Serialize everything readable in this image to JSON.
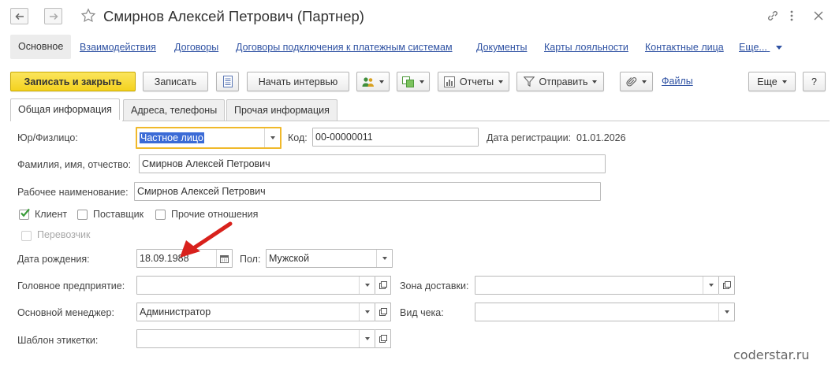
{
  "window": {
    "title": "Смирнов Алексей Петрович (Партнер)"
  },
  "nav": {
    "items": [
      {
        "label": "Основное"
      },
      {
        "label": "Взаимодействия"
      },
      {
        "label": "Договоры"
      },
      {
        "label": "Договоры подключения к платежным системам"
      },
      {
        "label": "Документы"
      },
      {
        "label": "Карты лояльности"
      },
      {
        "label": "Контактные лица"
      },
      {
        "label": "Еще..."
      }
    ]
  },
  "toolbar": {
    "save_close": "Записать и закрыть",
    "save": "Записать",
    "start_interview": "Начать интервью",
    "reports": "Отчеты",
    "send": "Отправить",
    "files": "Файлы",
    "more": "Еще",
    "help": "?"
  },
  "tabs": [
    {
      "label": "Общая информация",
      "active": true
    },
    {
      "label": "Адреса, телефоны",
      "active": false
    },
    {
      "label": "Прочая информация",
      "active": false
    }
  ],
  "form": {
    "legal_type": {
      "label": "Юр/Физлицо:",
      "value": "Частное лицо"
    },
    "code": {
      "label": "Код:",
      "value": "00-00000011"
    },
    "reg_date": {
      "label": "Дата регистрации:",
      "value": "01.01.2026"
    },
    "full_name": {
      "label": "Фамилия, имя, отчество:",
      "value": "Смирнов Алексей Петрович"
    },
    "work_name": {
      "label": "Рабочее наименование:",
      "value": "Смирнов Алексей Петрович"
    },
    "client": {
      "label": "Клиент",
      "checked": true
    },
    "supplier": {
      "label": "Поставщик",
      "checked": false
    },
    "other_relations": {
      "label": "Прочие отношения",
      "checked": false
    },
    "carrier": {
      "label": "Перевозчик",
      "checked": false,
      "disabled": true
    },
    "birth_date": {
      "label": "Дата рождения:",
      "value": "18.09.1988"
    },
    "gender": {
      "label": "Пол:",
      "value": "Мужской"
    },
    "head_company": {
      "label": "Головное предприятие:",
      "value": ""
    },
    "delivery_zone": {
      "label": "Зона доставки:",
      "value": ""
    },
    "main_manager": {
      "label": "Основной менеджер:",
      "value": "Администратор"
    },
    "receipt_type": {
      "label": "Вид чека:",
      "value": ""
    },
    "label_template": {
      "label": "Шаблон этикетки:",
      "value": ""
    }
  },
  "watermark": "coderstar.ru",
  "colors": {
    "accent_yellow": "#f4d21f",
    "link_blue": "#2f52a3",
    "focus_border": "#f0b92b",
    "selection": "#3b6bd6",
    "arrow_red": "#d8211c",
    "check_green": "#3a9c3a"
  }
}
